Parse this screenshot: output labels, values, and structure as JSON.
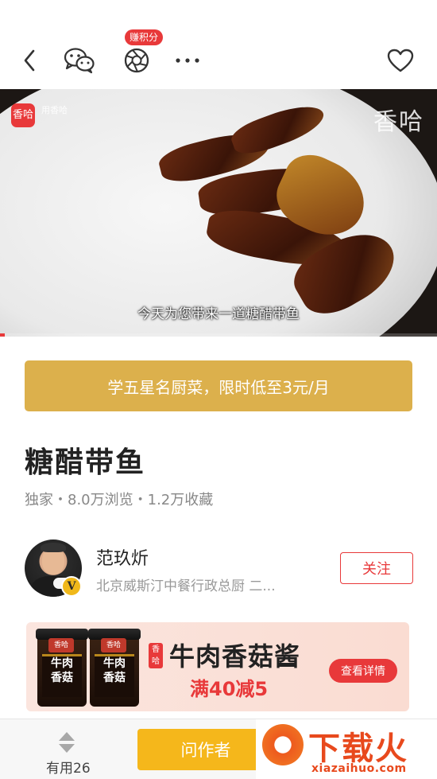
{
  "header": {
    "badge": "赚积分",
    "icons": [
      "back-icon",
      "wechat-icon",
      "camera-shutter-icon",
      "more-icon",
      "heart-icon"
    ]
  },
  "video": {
    "logo_text": "香哈",
    "logo_caption": "用香哈",
    "watermark": "香哈",
    "subtitle": "今天为您带来一道糖醋带鱼",
    "progress": 0.01
  },
  "promo": {
    "label": "学五星名厨菜，限时低至3元/月"
  },
  "recipe": {
    "title": "糖醋带鱼",
    "stats": "独家・8.0万浏览・1.2万收藏"
  },
  "author": {
    "name": "范玖炘",
    "title": "北京威斯汀中餐行政总厨 二...",
    "verified_mark": "V",
    "follow_label": "关注"
  },
  "ad": {
    "jar_logo": "香哈",
    "jar_text_1": "牛肉",
    "jar_text_2": "香菇",
    "brand_logo": "香哈",
    "title": "牛肉香菇酱",
    "subtitle": "满40减5",
    "button_label": "查看详情"
  },
  "bottom": {
    "useful_label": "有用26",
    "ask_label": "问作者",
    "watermark_text": "下载火",
    "watermark_url": "xiazaihuo.com"
  },
  "colors": {
    "accent_red": "#e8393a",
    "promo_gold": "#dcb04c",
    "ask_yellow": "#f5b71b"
  }
}
